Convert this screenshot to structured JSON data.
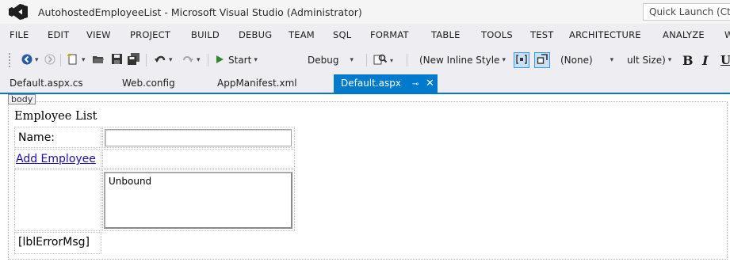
{
  "window": {
    "title": "AutohostedEmployeeList - Microsoft Visual Studio (Administrator)",
    "quick_launch": "Quick Launch (Ct"
  },
  "menu": {
    "items": [
      "FILE",
      "EDIT",
      "VIEW",
      "PROJECT",
      "BUILD",
      "DEBUG",
      "TEAM",
      "SQL",
      "FORMAT",
      "TABLE",
      "TOOLS",
      "TEST",
      "ARCHITECTURE",
      "ANALYZE",
      "W"
    ]
  },
  "toolbar": {
    "start_label": "Start",
    "config_label": "Debug",
    "style_combo": "(New Inline Style",
    "target_combo": "(None)",
    "size_combo": "ult Size)",
    "bold_label": "B",
    "italic_label": "I",
    "underline_label": "U"
  },
  "tabs": {
    "items": [
      "Default.aspx.cs",
      "Web.config",
      "AppManifest.xml"
    ],
    "active": "Default.aspx",
    "pin_glyph": "⊸",
    "close_glyph": "✕"
  },
  "designer": {
    "body_tag": "body",
    "page_title": "Employee List",
    "name_label": "Name:",
    "name_value": "",
    "add_link": "Add Employee",
    "list_text": "Unbound",
    "error_label": "[lblErrorMsg]"
  },
  "colors": {
    "accent": "#007acc",
    "link": "#1a0dab",
    "start_green": "#2e8b2e"
  }
}
